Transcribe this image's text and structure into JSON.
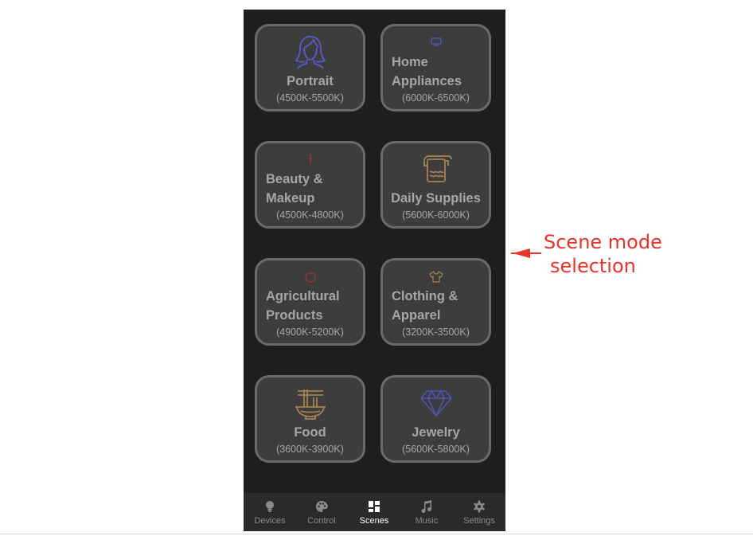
{
  "scenes": [
    {
      "icon": "woman-portrait-icon",
      "title": "Portrait",
      "range": "(4500K-5500K)"
    },
    {
      "icon": "tv-icon",
      "title_lines": [
        "Home",
        "Appliances"
      ],
      "range": "(6000K-6500K)"
    },
    {
      "icon": "lipstick-icon",
      "title_lines": [
        "Beauty &",
        "Makeup"
      ],
      "range": "(4500K-4800K)"
    },
    {
      "icon": "towel-icon",
      "title": "Daily Supplies",
      "range": "(5600K-6000K)"
    },
    {
      "icon": "apple-icon",
      "title_lines": [
        "Agricultural",
        "Products"
      ],
      "range": "(4900K-5200K)"
    },
    {
      "icon": "shirt-icon",
      "title_lines": [
        "Clothing &",
        "Apparel"
      ],
      "range": "(3200K-3500K)"
    },
    {
      "icon": "noodle-bowl-icon",
      "title": "Food",
      "range": "(3600K-3900K)"
    },
    {
      "icon": "diamond-icon",
      "title": "Jewelry",
      "range": "(5600K-5800K)"
    }
  ],
  "nav": [
    {
      "label": "Devices",
      "icon": "bulb-icon"
    },
    {
      "label": "Control",
      "icon": "palette-icon"
    },
    {
      "label": "Scenes",
      "icon": "grid-icon",
      "active": true
    },
    {
      "label": "Music",
      "icon": "music-note-icon"
    },
    {
      "label": "Settings",
      "icon": "gear-icon"
    }
  ],
  "annotation": {
    "line1": "Scene mode",
    "line2": "selection",
    "color": "#e8332a"
  },
  "colors": {
    "portrait": "#5a5ad0",
    "appliance": "#5a5ad0",
    "beauty": "#b03030",
    "supplies": "#a88050",
    "fruit": "#a33030",
    "shirt": "#a88050",
    "food": "#a88050",
    "jewel": "#5050b0"
  }
}
